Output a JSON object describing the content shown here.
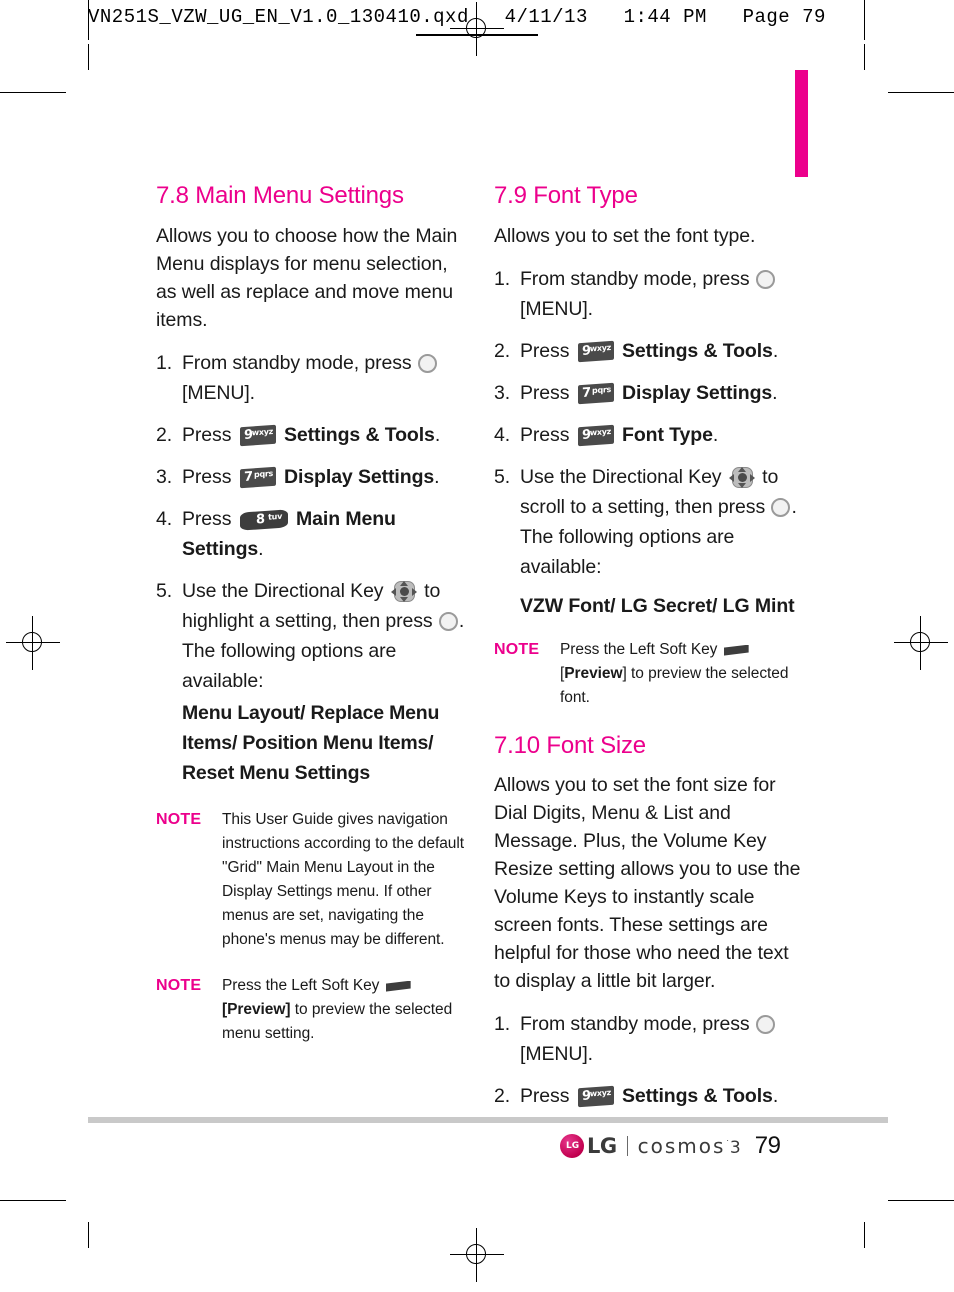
{
  "slug": {
    "text": "VN251S_VZW_UG_EN_V1.0_130410.qxd   4/11/13   1:44 PM   Page 79"
  },
  "colors": {
    "accent_pink": "#EC008C",
    "body_text": "#1a1a1a",
    "key_dark": "#4a4a4a",
    "footer_rule": "#c9c9c9"
  },
  "left_column": {
    "section": {
      "heading": "7.8 Main Menu Settings",
      "intro": "Allows you to choose how the Main Menu displays for menu selection, as well as replace and move menu items.",
      "steps": [
        {
          "num": "1.",
          "pre": "From standby mode, press",
          "icon": "ok-key-icon",
          "post": "[MENU]."
        },
        {
          "num": "2.",
          "pre": "Press",
          "icon": "keypad-9-wxyz",
          "key_digit": "9",
          "key_letters": "wxyz",
          "bold": "Settings & Tools",
          "post": "."
        },
        {
          "num": "3.",
          "pre": "Press",
          "icon": "keypad-7-pqrs",
          "key_digit": "7",
          "key_letters": "pqrs",
          "bold": "Display Settings",
          "post": "."
        },
        {
          "num": "4.",
          "pre": "Press",
          "icon": "keypad-8-tuv",
          "key_digit": "8",
          "key_letters": "tuv",
          "bold": "Main Menu Settings",
          "post": "."
        },
        {
          "num": "5.",
          "pre": "Use the Directional Key",
          "icon": "directional-key-icon",
          "mid": "to highlight a setting, then press",
          "icon2": "ok-key-icon",
          "post": ". The following options are available:",
          "options": "Menu Layout/ Replace Menu Items/ Position Menu Items/ Reset Menu Settings"
        }
      ],
      "notes": [
        {
          "label": "NOTE",
          "text": "This User Guide gives navigation instructions according to the default \"Grid\" Main Menu Layout in the Display Settings menu. If other menus are set, navigating the phone's menus may be different."
        },
        {
          "label": "NOTE",
          "pre": "Press the Left Soft Key",
          "icon": "left-soft-key-icon",
          "bracket_open": "[",
          "bold": "Preview",
          "bracket_close": "]",
          "post": "to preview the selected menu setting."
        }
      ]
    }
  },
  "right_column": {
    "sections": [
      {
        "heading": "7.9 Font Type",
        "intro": "Allows you to set the font type.",
        "steps": [
          {
            "num": "1.",
            "pre": "From standby mode, press",
            "icon": "ok-key-icon",
            "post": "[MENU]."
          },
          {
            "num": "2.",
            "pre": "Press",
            "icon": "keypad-9-wxyz",
            "key_digit": "9",
            "key_letters": "wxyz",
            "bold": "Settings & Tools",
            "post": "."
          },
          {
            "num": "3.",
            "pre": "Press",
            "icon": "keypad-7-pqrs",
            "key_digit": "7",
            "key_letters": "pqrs",
            "bold": "Display Settings",
            "post": "."
          },
          {
            "num": "4.",
            "pre": "Press",
            "icon": "keypad-9-wxyz",
            "key_digit": "9",
            "key_letters": "wxyz",
            "bold": "Font Type",
            "post": "."
          },
          {
            "num": "5.",
            "pre": "Use the Directional Key",
            "icon": "directional-key-icon",
            "mid": "to scroll to a setting, then press",
            "icon2": "ok-key-icon",
            "post": ". The following options are available:",
            "options": "VZW Font/ LG Secret/ LG Mint"
          }
        ],
        "notes": [
          {
            "label": "NOTE",
            "pre": "Press the Left Soft Key",
            "icon": "left-soft-key-icon",
            "bracket_open": "[",
            "bold": "Preview",
            "bracket_close": "]",
            "post": "to preview the selected font."
          }
        ]
      },
      {
        "heading": "7.10 Font Size",
        "intro": "Allows you to set the font size for Dial Digits, Menu & List and Message.  Plus, the Volume Key Resize setting allows you to use the Volume Keys to instantly scale screen fonts. These settings are helpful for those who need the text to display a little bit larger.",
        "steps": [
          {
            "num": "1.",
            "pre": "From standby mode, press",
            "icon": "ok-key-icon",
            "post": "[MENU]."
          },
          {
            "num": "2.",
            "pre": "Press",
            "icon": "keypad-9-wxyz",
            "key_digit": "9",
            "key_letters": "wxyz",
            "bold": "Settings & Tools",
            "post": "."
          }
        ],
        "notes": []
      }
    ]
  },
  "footer": {
    "brand": "LG",
    "divider": "|",
    "product": "cosmos",
    "trademark": "˙",
    "product_number": "3",
    "page_number": "79"
  }
}
